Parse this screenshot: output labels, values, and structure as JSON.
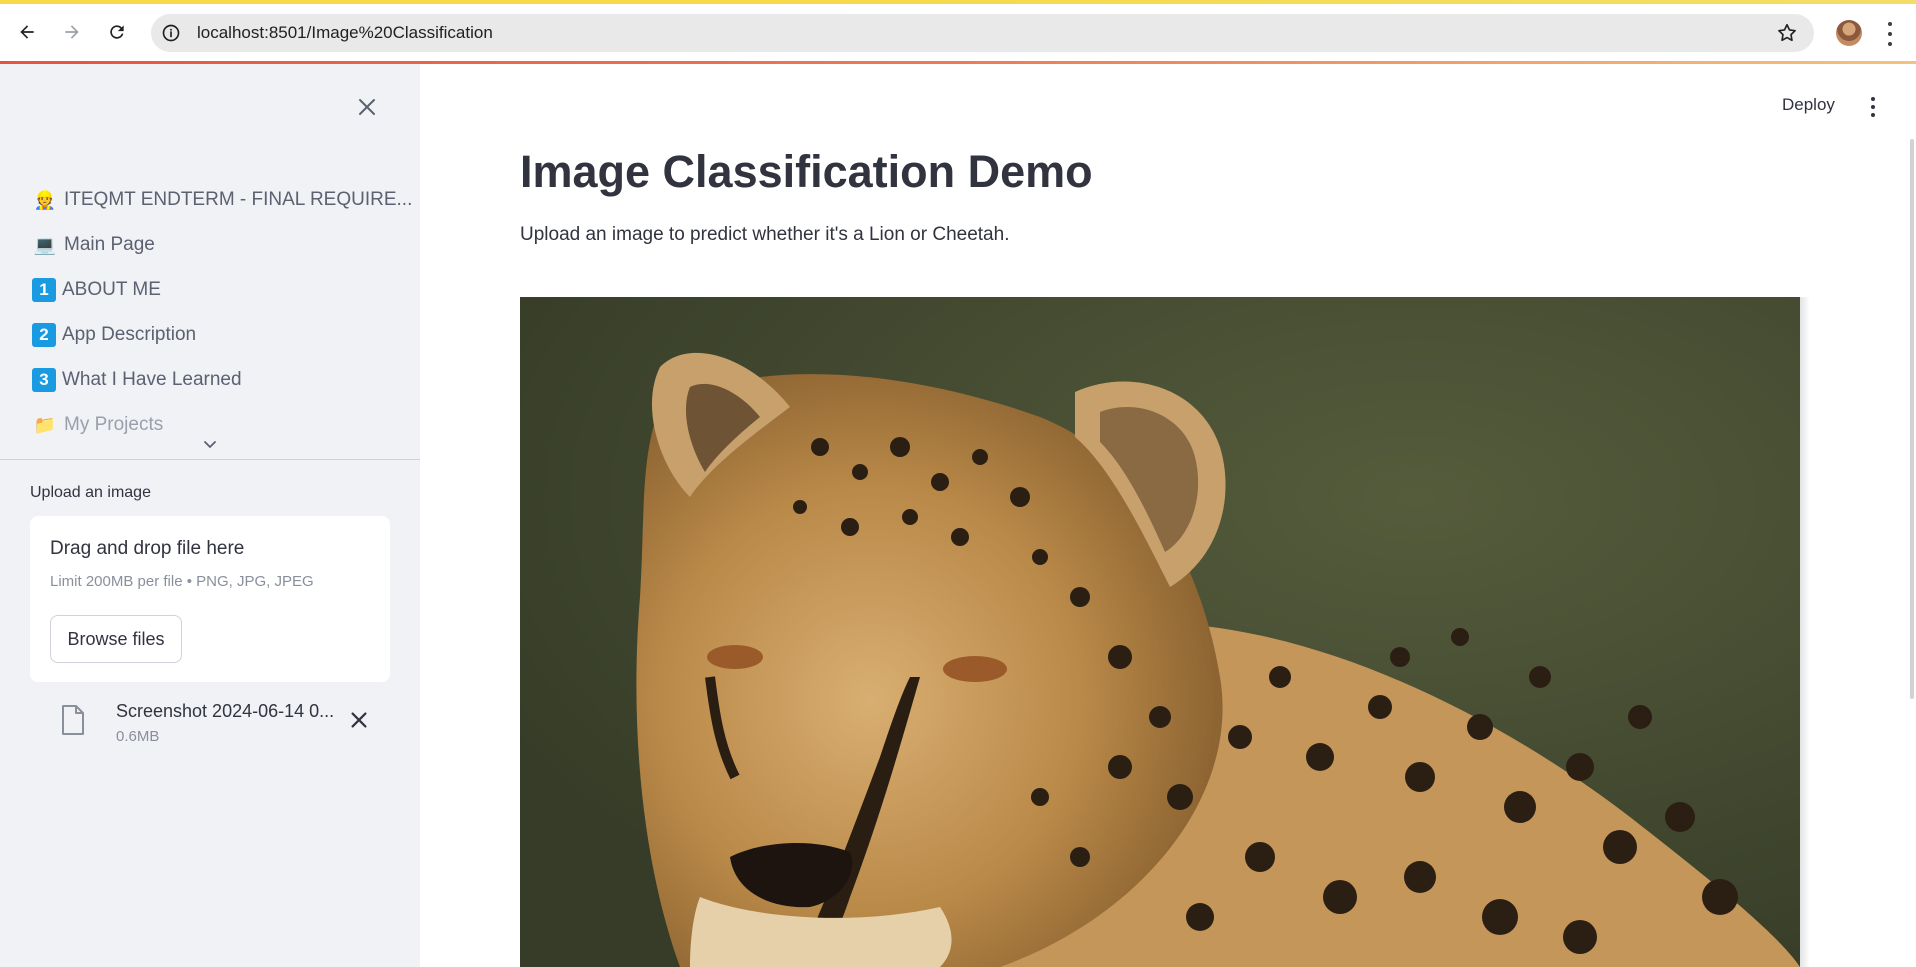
{
  "browser": {
    "url": "localhost:8501/Image%20Classification"
  },
  "sidebar": {
    "nav_items": [
      {
        "icon": "👷",
        "label": "ITEQMT ENDTERM - FINAL REQUIRE..."
      },
      {
        "icon": "💻",
        "label": "Main Page"
      },
      {
        "icon": "1",
        "label": "ABOUT ME"
      },
      {
        "icon": "2",
        "label": "App Description"
      },
      {
        "icon": "3",
        "label": "What I Have Learned"
      },
      {
        "icon": "📁",
        "label": "My Projects"
      }
    ],
    "uploader": {
      "label": "Upload an image",
      "drop_title": "Drag and drop file here",
      "drop_limit": "Limit 200MB per file • PNG, JPG, JPEG",
      "browse_label": "Browse files",
      "file": {
        "name": "Screenshot 2024-06-14 0...",
        "size": "0.6MB"
      }
    }
  },
  "header": {
    "deploy_label": "Deploy"
  },
  "main": {
    "title": "Image Classification Demo",
    "description": "Upload an image to predict whether it's a Lion or Cheetah."
  },
  "colors": {
    "sidebar_bg": "#f0f2f6",
    "text": "#31333f",
    "number_badge": "#1a9ae0"
  }
}
